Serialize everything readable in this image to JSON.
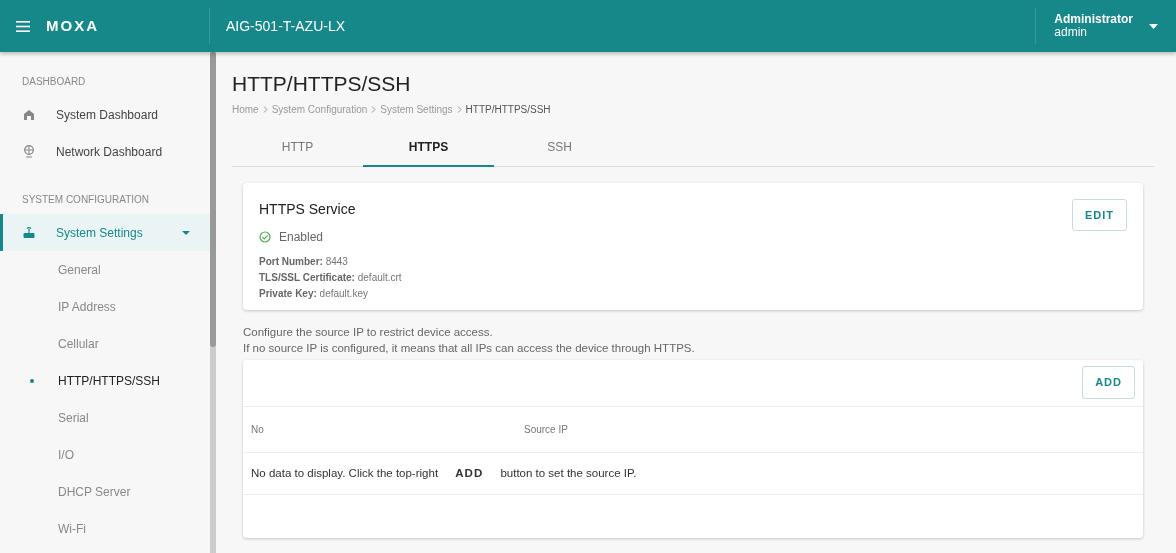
{
  "topbar": {
    "logo": "MOXA",
    "device": "AIG-501-T-AZU-LX",
    "user": {
      "role": "Administrator",
      "name": "admin"
    }
  },
  "sidebar": {
    "sections": [
      {
        "title": "DASHBOARD",
        "items": [
          {
            "label": "System Dashboard",
            "selected": false
          },
          {
            "label": "Network Dashboard",
            "selected": false
          }
        ]
      },
      {
        "title": "SYSTEM CONFIGURATION",
        "items": [
          {
            "label": "System Settings",
            "selected": true,
            "expanded": true,
            "children": [
              {
                "label": "General",
                "selected": false
              },
              {
                "label": "IP Address",
                "selected": false
              },
              {
                "label": "Cellular",
                "selected": false
              },
              {
                "label": "HTTP/HTTPS/SSH",
                "selected": true
              },
              {
                "label": "Serial",
                "selected": false
              },
              {
                "label": "I/O",
                "selected": false
              },
              {
                "label": "DHCP Server",
                "selected": false
              },
              {
                "label": "Wi-Fi",
                "selected": false
              }
            ]
          }
        ]
      }
    ]
  },
  "page": {
    "title": "HTTP/HTTPS/SSH",
    "breadcrumb": [
      "Home",
      "System Configuration",
      "System Settings",
      "HTTP/HTTPS/SSH"
    ]
  },
  "tabs": [
    {
      "label": "HTTP",
      "selected": false
    },
    {
      "label": "HTTPS",
      "selected": true
    },
    {
      "label": "SSH",
      "selected": false
    }
  ],
  "service_card": {
    "title": "HTTPS Service",
    "status": "Enabled",
    "enabled": true,
    "button": "EDIT",
    "details": [
      {
        "label": "Port Number:",
        "value": "8443"
      },
      {
        "label": "TLS/SSL Certificate:",
        "value": "default.crt"
      },
      {
        "label": "Private Key:",
        "value": "default.key"
      }
    ]
  },
  "description": [
    "Configure the source IP to restrict device access.",
    "If no source IP is configured, it means that all IPs can access the device through HTTPS."
  ],
  "table": {
    "button": "ADD",
    "columns": [
      "No",
      "Source IP"
    ],
    "empty_message": "No data to display. Click the top-right **ADD** button to set the source IP."
  }
}
